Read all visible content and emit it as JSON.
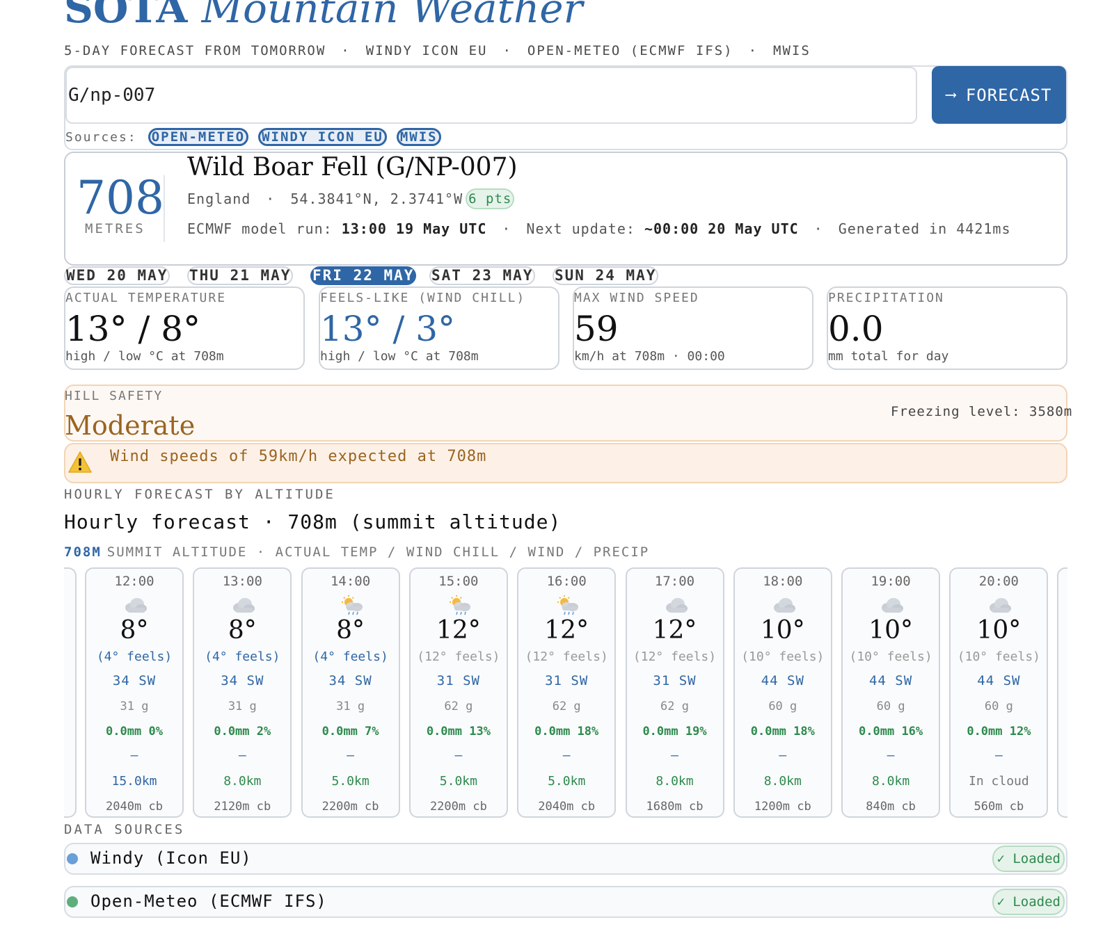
{
  "header": {
    "title_bold": "SOTA",
    "title_italic": "Mountain Weather",
    "subtitle_parts": [
      "5-DAY FORECAST FROM TOMORROW",
      "WINDY ICON EU",
      "OPEN-METEO (ECMWF IFS)",
      "MWIS"
    ]
  },
  "search": {
    "value": "G/np-007",
    "button_label": "FORECAST",
    "button_icon": "arrow-right-icon",
    "sources_label": "Sources:",
    "sources": [
      "OPEN-METEO",
      "WINDY ICON EU",
      "MWIS"
    ]
  },
  "summit": {
    "altitude": "708",
    "altitude_unit": "METRES",
    "name": "Wild Boar Fell (G/NP-007)",
    "country": "England",
    "coords": "54.3841°N, 2.3741°W",
    "points": "6 pts",
    "model_run_label": "ECMWF model run:",
    "model_run_value": "13:00 19 May UTC",
    "next_update_label": "Next update:",
    "next_update_value": "~00:00 20 May UTC",
    "generated": "Generated in 4421ms"
  },
  "days": [
    {
      "label": "WED 20 MAY",
      "active": false
    },
    {
      "label": "THU 21 MAY",
      "active": false
    },
    {
      "label": "FRI 22 MAY",
      "active": true
    },
    {
      "label": "SAT 23 MAY",
      "active": false
    },
    {
      "label": "SUN 24 MAY",
      "active": false
    }
  ],
  "stats": [
    {
      "label": "ACTUAL TEMPERATURE",
      "value": "13° / 8°",
      "sub": "high / low °C at 708m",
      "accent": false
    },
    {
      "label": "FEELS-LIKE (WIND CHILL)",
      "value": "13° / 3°",
      "sub": "high / low °C at 708m",
      "accent": true
    },
    {
      "label": "MAX WIND SPEED",
      "value": "59",
      "sub": "km/h at 708m · 00:00",
      "accent": false
    },
    {
      "label": "PRECIPITATION",
      "value": "0.0",
      "sub": "mm total for day",
      "accent": false
    }
  ],
  "safety": {
    "label": "HILL SAFETY",
    "level": "Moderate",
    "freezing": "Freezing level: 3580m",
    "warning": "Wind speeds of 59km/h expected at 708m",
    "warning_icon": "warning-triangle-icon"
  },
  "hourly": {
    "section_label": "HOURLY FORECAST BY ALTITUDE",
    "title": "Hourly forecast · 708m (summit altitude)",
    "alt_tag": "708M",
    "alt_desc": "SUMMIT ALTITUDE · ACTUAL TEMP / WIND CHILL / WIND / PRECIP",
    "hours": [
      {
        "time": "12:00",
        "icon": "cloud-icon",
        "temp": "8°",
        "feels": "(4° feels)",
        "cold": true,
        "wind": "34 SW",
        "gust": "31 g",
        "precip": "0.0mm 0%",
        "dash": "–",
        "vis": "15.0km",
        "vis_style": "blue",
        "cb": "2040m cb"
      },
      {
        "time": "13:00",
        "icon": "cloud-icon",
        "temp": "8°",
        "feels": "(4° feels)",
        "cold": true,
        "wind": "34 SW",
        "gust": "31 g",
        "precip": "0.0mm 2%",
        "dash": "–",
        "vis": "8.0km",
        "vis_style": "green",
        "cb": "2120m cb"
      },
      {
        "time": "14:00",
        "icon": "sun-rain-icon",
        "temp": "8°",
        "feels": "(4° feels)",
        "cold": true,
        "wind": "34 SW",
        "gust": "31 g",
        "precip": "0.0mm 7%",
        "dash": "–",
        "vis": "5.0km",
        "vis_style": "green",
        "cb": "2200m cb"
      },
      {
        "time": "15:00",
        "icon": "sun-rain-icon",
        "temp": "12°",
        "feels": "(12° feels)",
        "cold": false,
        "wind": "31 SW",
        "gust": "62 g",
        "precip": "0.0mm 13%",
        "dash": "–",
        "vis": "5.0km",
        "vis_style": "green",
        "cb": "2200m cb"
      },
      {
        "time": "16:00",
        "icon": "sun-rain-icon",
        "temp": "12°",
        "feels": "(12° feels)",
        "cold": false,
        "wind": "31 SW",
        "gust": "62 g",
        "precip": "0.0mm 18%",
        "dash": "–",
        "vis": "5.0km",
        "vis_style": "green",
        "cb": "2040m cb"
      },
      {
        "time": "17:00",
        "icon": "cloud-icon",
        "temp": "12°",
        "feels": "(12° feels)",
        "cold": false,
        "wind": "31 SW",
        "gust": "62 g",
        "precip": "0.0mm 19%",
        "dash": "–",
        "vis": "8.0km",
        "vis_style": "green",
        "cb": "1680m cb"
      },
      {
        "time": "18:00",
        "icon": "cloud-icon",
        "temp": "10°",
        "feels": "(10° feels)",
        "cold": false,
        "wind": "44 SW",
        "gust": "60 g",
        "precip": "0.0mm 18%",
        "dash": "–",
        "vis": "8.0km",
        "vis_style": "green",
        "cb": "1200m cb"
      },
      {
        "time": "19:00",
        "icon": "cloud-icon",
        "temp": "10°",
        "feels": "(10° feels)",
        "cold": false,
        "wind": "44 SW",
        "gust": "60 g",
        "precip": "0.0mm 16%",
        "dash": "–",
        "vis": "8.0km",
        "vis_style": "green",
        "cb": "840m cb"
      },
      {
        "time": "20:00",
        "icon": "cloud-icon",
        "temp": "10°",
        "feels": "(10° feels)",
        "cold": false,
        "wind": "44 SW",
        "gust": "60 g",
        "precip": "0.0mm 12%",
        "dash": "–",
        "vis": "In cloud",
        "vis_style": "grey",
        "cb": "560m cb"
      }
    ]
  },
  "data_sources": {
    "label": "DATA SOURCES",
    "items": [
      {
        "name": "Windy (Icon EU)",
        "status": "✓ Loaded",
        "color": "#6a9fd8"
      },
      {
        "name": "Open-Meteo (ECMWF IFS)",
        "status": "✓ Loaded",
        "color": "#5fae7c"
      }
    ]
  },
  "colors": {
    "accent": "#2f66a5",
    "warning": "#9a6420",
    "ok": "#2e8a4e"
  }
}
